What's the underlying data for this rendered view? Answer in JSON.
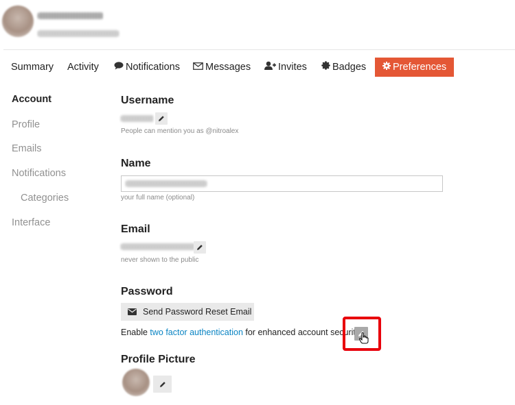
{
  "header": {
    "avatar_icon": "user-avatar",
    "redacted_name": "",
    "redacted_subtitle": ""
  },
  "tabs": [
    {
      "label": "Summary",
      "icon": ""
    },
    {
      "label": "Activity",
      "icon": ""
    },
    {
      "label": "Notifications",
      "icon": "comment-icon"
    },
    {
      "label": "Messages",
      "icon": "envelope-icon"
    },
    {
      "label": "Invites",
      "icon": "user-plus-icon"
    },
    {
      "label": "Badges",
      "icon": "certificate-icon"
    },
    {
      "label": "Preferences",
      "icon": "gear-icon",
      "active": true
    }
  ],
  "sidebar": {
    "items": [
      {
        "label": "Account",
        "active": true
      },
      {
        "label": "Profile"
      },
      {
        "label": "Emails"
      },
      {
        "label": "Notifications"
      },
      {
        "label": "Categories",
        "indent": true
      },
      {
        "label": "Interface"
      }
    ]
  },
  "account": {
    "username": {
      "title": "Username",
      "help": "People can mention you as @nitroalex",
      "edit_icon": "pencil-icon"
    },
    "name": {
      "title": "Name",
      "help": "your full name (optional)"
    },
    "email": {
      "title": "Email",
      "help": "never shown to the public",
      "edit_icon": "pencil-icon"
    },
    "password": {
      "title": "Password",
      "reset_label": "Send Password Reset Email",
      "reset_icon": "envelope-icon",
      "twofa_prefix": "Enable ",
      "twofa_link": "two factor authentication",
      "twofa_suffix": " for enhanced account security",
      "twofa_edit_icon": "pencil-icon"
    },
    "profile_picture": {
      "title": "Profile Picture",
      "edit_icon": "pencil-icon"
    }
  },
  "colors": {
    "accent": "#e45735",
    "link": "#0a84c3",
    "highlight": "#e8000b",
    "button_bg": "#e9e9e9",
    "muted_text": "#919191"
  }
}
